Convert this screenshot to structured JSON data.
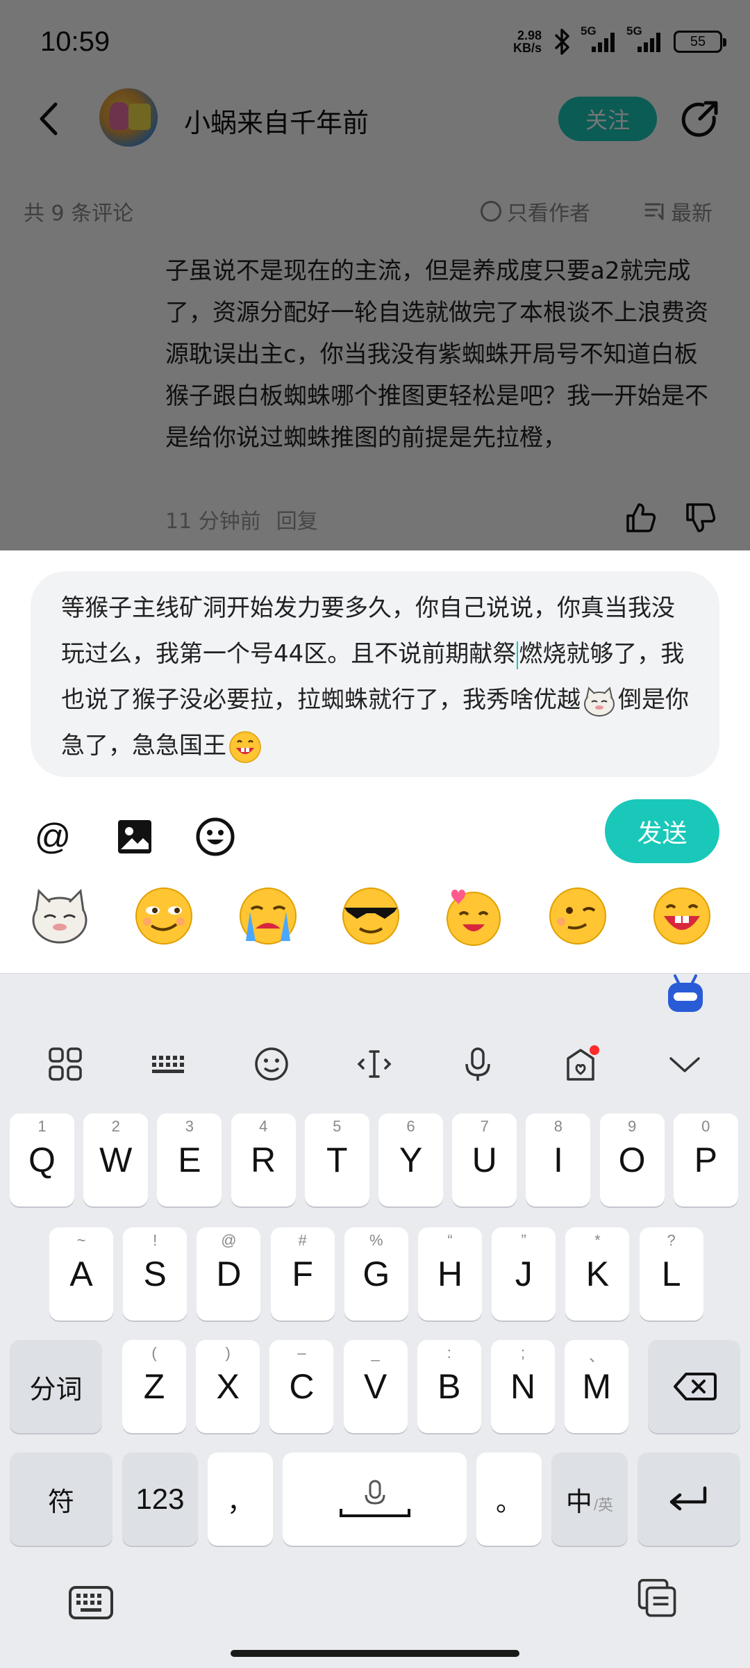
{
  "status_bar": {
    "time": "10:59",
    "net_speed_value": "2.98",
    "net_speed_unit": "KB/s",
    "sim1": "5G",
    "sim2": "5G",
    "battery": "55"
  },
  "header": {
    "username": "小蜗来自千年前",
    "follow_label": "关注"
  },
  "comments_bar": {
    "count_label": "共 9 条评论",
    "only_author_label": "只看作者",
    "sort_label": "最新"
  },
  "comment": {
    "text": "子虽说不是现在的主流，但是养成度只要a2就完成了，资源分配好一轮自选就做完了本根谈不上浪费资源耽误出主c，你当我没有紫蜘蛛开局号不知道白板猴子跟白板蜘蛛哪个推图更轻松是吧？我一开始是不是给你说过蜘蛛推图的前提是先拉橙，",
    "time": "11 分钟前",
    "reply_label": "回复"
  },
  "input": {
    "text_before_caret": "等猴子主线矿洞开始发力要多久，你自己说说，你真当我没玩过么，我第一个号44区。且不说前期献祭",
    "text_after_caret": "燃烧就够了，我也说了猴子没必要拉，拉蜘蛛就行了，我秀啥优越",
    "text_after_emoji1": "倒是你急了，急急国王"
  },
  "send_label": "发送",
  "accent_color": "#19c8b9",
  "keyboard": {
    "row1": [
      {
        "hint": "1",
        "key": "Q"
      },
      {
        "hint": "2",
        "key": "W"
      },
      {
        "hint": "3",
        "key": "E"
      },
      {
        "hint": "4",
        "key": "R"
      },
      {
        "hint": "5",
        "key": "T"
      },
      {
        "hint": "6",
        "key": "Y"
      },
      {
        "hint": "7",
        "key": "U"
      },
      {
        "hint": "8",
        "key": "I"
      },
      {
        "hint": "9",
        "key": "O"
      },
      {
        "hint": "0",
        "key": "P"
      }
    ],
    "row2": [
      {
        "hint": "~",
        "key": "A"
      },
      {
        "hint": "!",
        "key": "S"
      },
      {
        "hint": "@",
        "key": "D"
      },
      {
        "hint": "#",
        "key": "F"
      },
      {
        "hint": "%",
        "key": "G"
      },
      {
        "hint": "“",
        "key": "H"
      },
      {
        "hint": "”",
        "key": "J"
      },
      {
        "hint": "*",
        "key": "K"
      },
      {
        "hint": "?",
        "key": "L"
      }
    ],
    "row3": [
      {
        "hint": "(",
        "key": "Z"
      },
      {
        "hint": ")",
        "key": "X"
      },
      {
        "hint": "–",
        "key": "C"
      },
      {
        "hint": "_",
        "key": "V"
      },
      {
        "hint": ":",
        "key": "B"
      },
      {
        "hint": ";",
        "key": "N"
      },
      {
        "hint": "、",
        "key": "M"
      }
    ],
    "fenci_label": "分词",
    "symbol_label": "符",
    "num_label": "123",
    "comma_label": "，",
    "period_label": "。",
    "lang_main": "中",
    "lang_alt": "/英"
  }
}
